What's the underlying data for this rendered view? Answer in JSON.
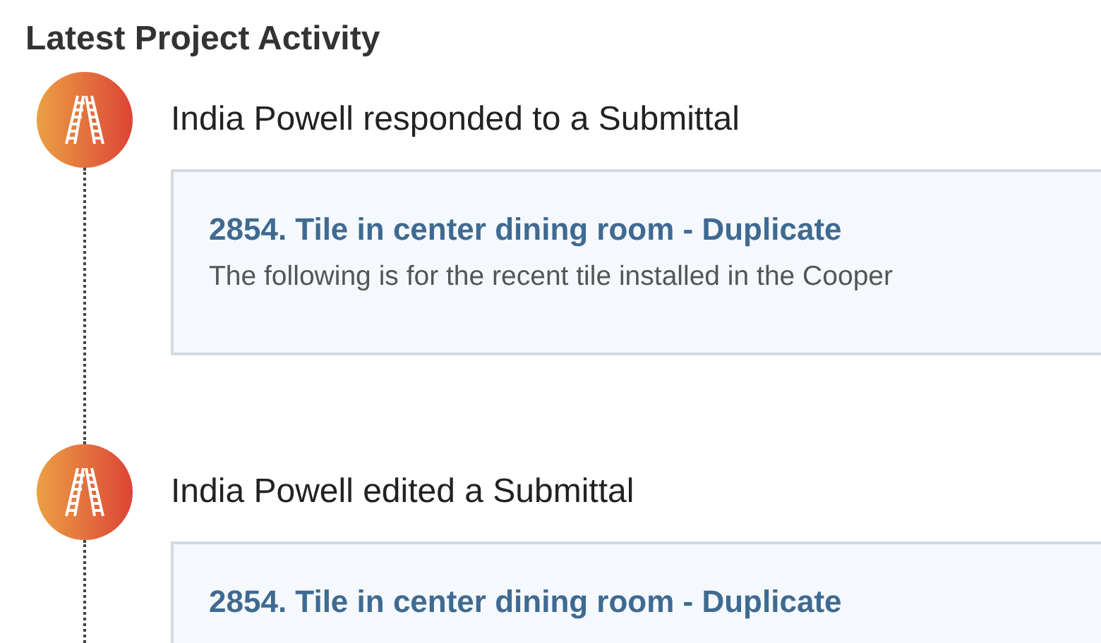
{
  "heading": "Latest Project Activity",
  "activities": [
    {
      "summary": "India Powell responded to a Submittal",
      "card": {
        "title": "2854. Tile in center dining room - Duplicate",
        "description": "The following is for the recent tile installed in the Cooper"
      }
    },
    {
      "summary": "India Powell edited a Submittal",
      "card": {
        "title": "2854. Tile in center dining room - Duplicate"
      }
    }
  ]
}
